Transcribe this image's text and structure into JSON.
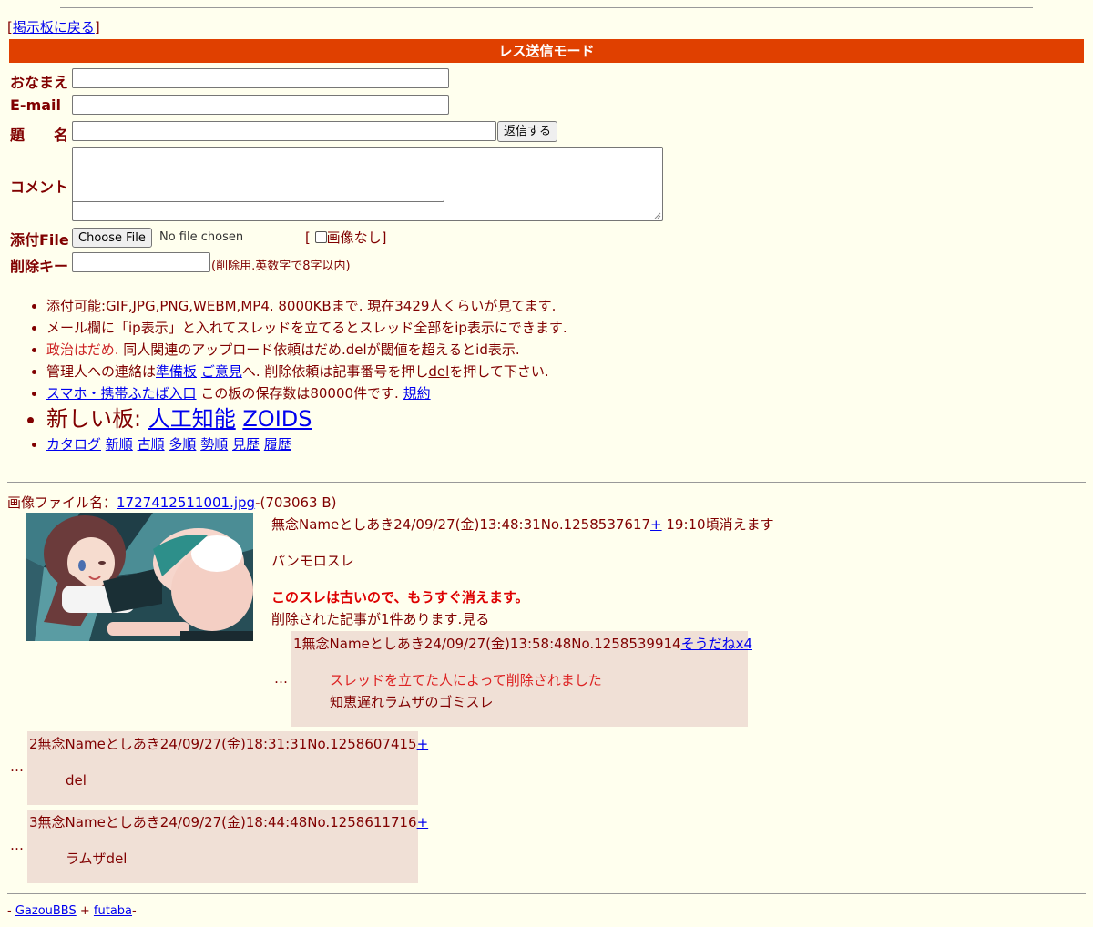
{
  "nav": {
    "back_open": "[",
    "back_label": "掲示板に戻る",
    "back_close": "]"
  },
  "mode_bar": "レス送信モード",
  "form": {
    "name_label": "おなまえ",
    "email_label": "E-mail",
    "subject_label": "題　　名",
    "submit_label": "返信する",
    "comment_label": "コメント",
    "file_label": "添付File",
    "file_button": "Choose File",
    "file_status": "No file chosen",
    "noimage_open": "[",
    "noimage_label": "画像なし",
    "noimage_close": "]",
    "delkey_label": "削除キー",
    "delkey_hint": "(削除用.英数字で8字以内)"
  },
  "notes": {
    "line1": "添付可能:GIF,JPG,PNG,WEBM,MP4. 8000KBまで. 現在3429人くらいが見てます.",
    "line2": "メール欄に「ip表示」と入れてスレッドを立てるとスレッド全部をip表示にできます.",
    "line3_red": "政治はだめ.",
    "line3_rest": " 同人関連のアップロード依頼はだめ.delが閾値を超えるとid表示.",
    "line4_a": "管理人への連絡は",
    "line4_link1": "準備板",
    "line4_link2": "ご意見",
    "line4_b": "へ. 削除依頼は記事番号を押し",
    "line4_del": "del",
    "line4_c": "を押して下さい.",
    "line5_link1": "スマホ・携帯ふたば入口",
    "line5_b": " この板の保存数は80000件です. ",
    "line5_link2": "規約",
    "line6_prefix": "新しい板: ",
    "line6_link1": "人工知能",
    "line6_link2": "ZOIDS",
    "line7_links": [
      "カタログ",
      "新順",
      "古順",
      "多順",
      "勢順",
      "見歴",
      "履歴"
    ]
  },
  "op": {
    "file_prefix": "画像ファイル名：",
    "file_name": "1727412511001.jpg",
    "file_size": "-(703063 B)",
    "header": "無念Nameとしあき24/09/27(金)13:48:31No.1258537617",
    "plus": "+",
    "expire": " 19:10頃消えます",
    "body": "パンモロスレ",
    "old_warning": "このスレは古いので、もうすぐ消えます。",
    "deleted_note": "削除された記事が1件あります.見る"
  },
  "replies": [
    {
      "ellipsis": "…",
      "header": "1無念Nameとしあき24/09/27(金)13:58:48No.1258539914",
      "link": "そうだねx4",
      "deleted_msg": "スレッドを立てた人によって削除されました",
      "body": "知恵遅れラムザのゴミスレ"
    },
    {
      "ellipsis": "…",
      "header": "2無念Nameとしあき24/09/27(金)18:31:31No.1258607415",
      "link": "+",
      "body": "del"
    },
    {
      "ellipsis": "…",
      "header": "3無念Nameとしあき24/09/27(金)18:44:48No.1258611716",
      "link": "+",
      "body": "ラムザdel"
    }
  ],
  "footer": {
    "dash1": "- ",
    "link1": "GazouBBS",
    "plus": " + ",
    "link2": "futaba",
    "dash2": "-"
  },
  "colors": {
    "background": "#ffffee",
    "text": "#800000",
    "mode_bar": "#e04000",
    "reply_bg": "#f0e0d6",
    "link": "#0000ee",
    "warning": "#dd0000"
  }
}
